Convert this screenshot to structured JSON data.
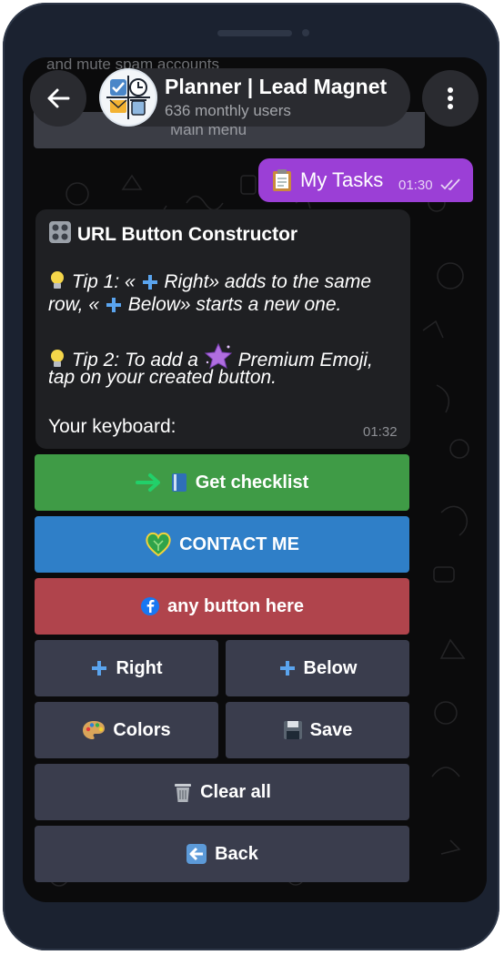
{
  "previous": {
    "partial_text": "and mute spam accounts",
    "partial_button": "Main menu"
  },
  "header": {
    "title": "Planner | Lead Magnet",
    "subtitle": "636 monthly users"
  },
  "outgoing": {
    "text": "My Tasks",
    "time": "01:30"
  },
  "incoming": {
    "heading": "URL Button Constructor",
    "tip1_line1_pre": "Tip 1: «",
    "tip1_line1_post": " Right» adds to the same",
    "tip1_line2_pre": "row, «",
    "tip1_line2_post": " Below» starts a new one.",
    "tip2_line1_pre": "Tip 2: To add a",
    "tip2_line1_post": "Premium Emoji,",
    "tip2_line2": "tap on your created button.",
    "keyboard_label": "Your keyboard:",
    "time": "01:32"
  },
  "keyboard": {
    "checklist": "Get checklist",
    "contact": "CONTACT ME",
    "any": "any button here",
    "right": "Right",
    "below": "Below",
    "colors": "Colors",
    "save": "Save",
    "clear": "Clear all",
    "back": "Back"
  },
  "colors": {
    "green_button": "#3f9b46",
    "blue_button": "#2f7fc8",
    "red_button": "#b0444c",
    "plain_button": "#3a3d4d",
    "outgoing_bubble": "#9b3fd6",
    "incoming_bubble": "#1f2023"
  },
  "icons": [
    "back-arrow-icon",
    "more-vertical-icon",
    "clipboard-icon",
    "double-check-icon",
    "control-knobs-icon",
    "lightbulb-icon",
    "plus-icon",
    "star-icon",
    "arrow-right-icon",
    "book-icon",
    "heart-icon",
    "facebook-icon",
    "palette-icon",
    "floppy-disk-icon",
    "trash-icon",
    "back-icon"
  ]
}
